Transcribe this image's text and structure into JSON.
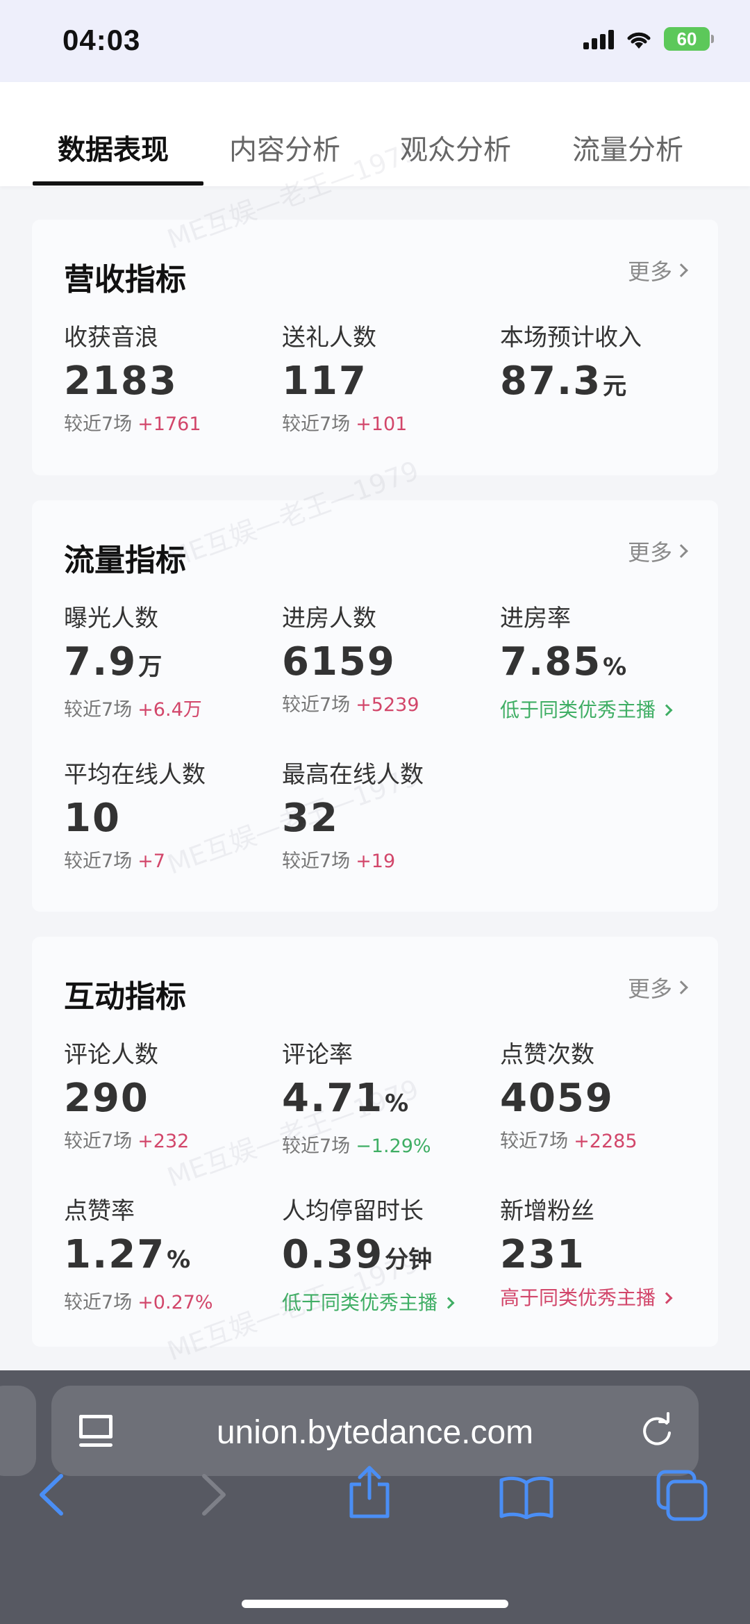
{
  "status_bar": {
    "time": "04:03",
    "battery": "60"
  },
  "tabs": [
    {
      "label": "数据表现",
      "active": true
    },
    {
      "label": "内容分析",
      "active": false
    },
    {
      "label": "观众分析",
      "active": false
    },
    {
      "label": "流量分析",
      "active": false
    }
  ],
  "watermark": "ME互娱—老王—1979",
  "cards": {
    "revenue": {
      "title": "营收指标",
      "more": "更多",
      "metrics": [
        {
          "label": "收获音浪",
          "value": "2183",
          "compare": "较近7场",
          "delta": "+1761"
        },
        {
          "label": "送礼人数",
          "value": "117",
          "compare": "较近7场",
          "delta": "+101"
        },
        {
          "label": "本场预计收入",
          "value": "87.3",
          "unit": "元"
        }
      ]
    },
    "traffic": {
      "title": "流量指标",
      "more": "更多",
      "metrics": [
        {
          "label": "曝光人数",
          "value": "7.9",
          "unit": "万",
          "compare": "较近7场",
          "delta": "+6.4万"
        },
        {
          "label": "进房人数",
          "value": "6159",
          "compare": "较近7场",
          "delta": "+5239"
        },
        {
          "label": "进房率",
          "value": "7.85",
          "unit": "%",
          "note": "低于同类优秀主播"
        },
        {
          "label": "平均在线人数",
          "value": "10",
          "compare": "较近7场",
          "delta": "+7"
        },
        {
          "label": "最高在线人数",
          "value": "32",
          "compare": "较近7场",
          "delta": "+19"
        }
      ]
    },
    "interaction": {
      "title": "互动指标",
      "more": "更多",
      "metrics": [
        {
          "label": "评论人数",
          "value": "290",
          "compare": "较近7场",
          "delta": "+232"
        },
        {
          "label": "评论率",
          "value": "4.71",
          "unit": "%",
          "compare": "较近7场",
          "delta": "−1.29%"
        },
        {
          "label": "点赞次数",
          "value": "4059",
          "compare": "较近7场",
          "delta": "+2285"
        },
        {
          "label": "点赞率",
          "value": "1.27",
          "unit": "%",
          "compare": "较近7场",
          "delta": "+0.27%"
        },
        {
          "label": "人均停留时长",
          "value": "0.39",
          "unit": "分钟",
          "note": "低于同类优秀主播"
        },
        {
          "label": "新增粉丝",
          "value": "231",
          "note": "高于同类优秀主播"
        }
      ]
    }
  },
  "browser": {
    "url": "union.bytedance.com"
  },
  "colors": {
    "positive_delta": "#d2466a",
    "negative_delta": "#3fae64",
    "toolbar_icon": "#4a8ef5"
  }
}
